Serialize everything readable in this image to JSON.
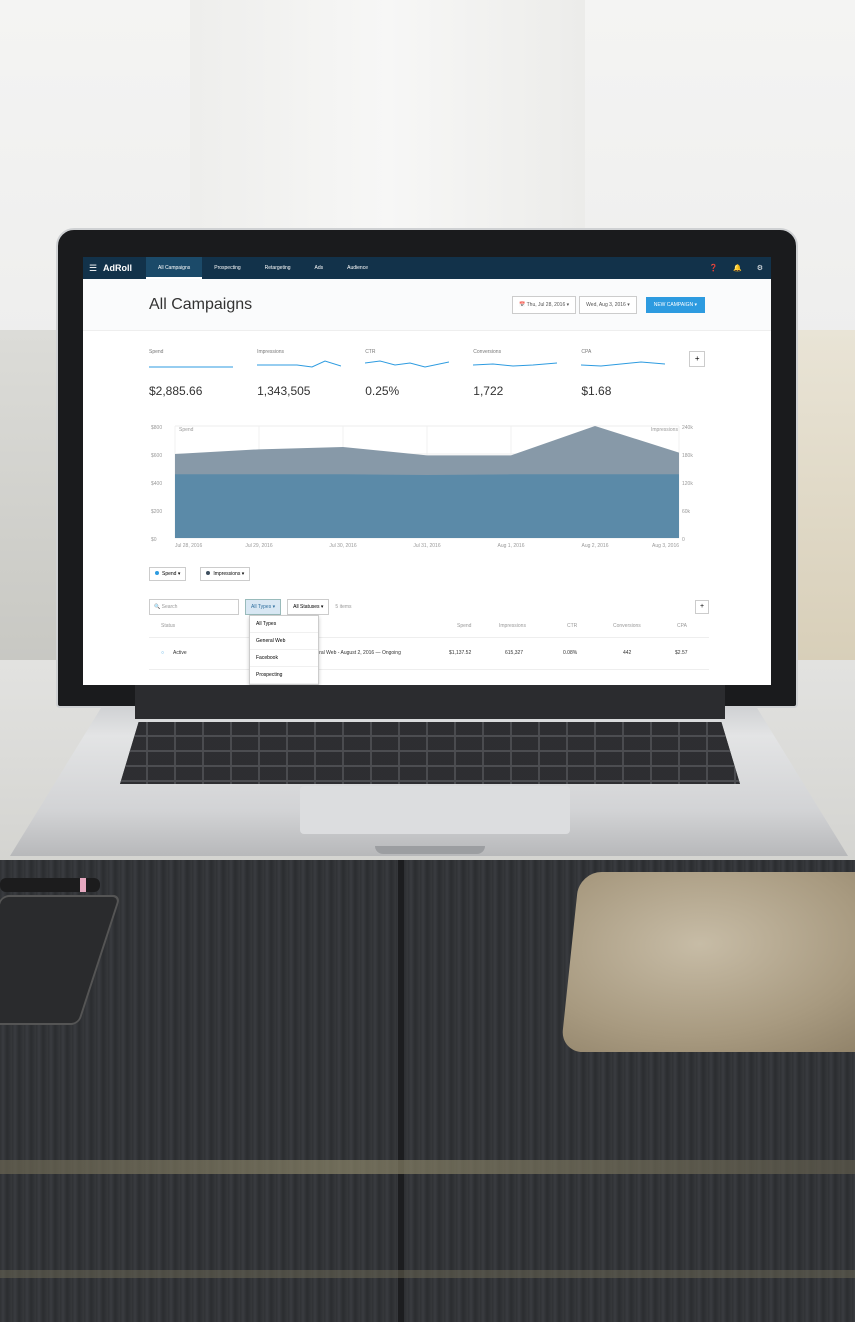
{
  "app": {
    "logo": "AdRoll"
  },
  "nav": {
    "tabs": [
      "All Campaigns",
      "Prospecting",
      "Retargeting",
      "Ads",
      "Audience"
    ],
    "active": "All Campaigns"
  },
  "header": {
    "title": "All Campaigns",
    "start_date": "Thu, Jul 28, 2016",
    "end_date": "Wed, Aug 3, 2016",
    "new_campaign": "NEW CAMPAIGN"
  },
  "metrics": [
    {
      "label": "Spend",
      "value": "$2,885.66"
    },
    {
      "label": "Impressions",
      "value": "1,343,505"
    },
    {
      "label": "CTR",
      "value": "0.25%"
    },
    {
      "label": "Conversions",
      "value": "1,722"
    },
    {
      "label": "CPA",
      "value": "$1.68"
    }
  ],
  "colors": {
    "accent": "#2d9be0",
    "nav": "#12324a",
    "spend_area": "#5b8aa8",
    "impressions_area": "#8799a8"
  },
  "chart_data": {
    "type": "area",
    "x": [
      "Jul 28, 2016",
      "Jul 29, 2016",
      "Jul 30, 2016",
      "Jul 31, 2016",
      "Aug 1, 2016",
      "Aug 2, 2016",
      "Aug 3, 2016"
    ],
    "y_left_label": "Spend",
    "y_right_label": "Impressions",
    "y_left_ticks": [
      "$800",
      "$600",
      "$400",
      "$200",
      "$0"
    ],
    "y_right_ticks": [
      "240k",
      "180k",
      "120k",
      "60k",
      "0"
    ],
    "ylim": [
      0,
      800
    ],
    "series": [
      {
        "name": "Impressions",
        "axis": "right",
        "values": [
          180000,
          190000,
          195000,
          177000,
          177000,
          240000,
          183000
        ]
      },
      {
        "name": "Spend",
        "axis": "left",
        "values": [
          455,
          455,
          455,
          450,
          455,
          455,
          455
        ]
      }
    ],
    "legend": [
      "Spend",
      "Impressions"
    ]
  },
  "filters": {
    "search_placeholder": "Search",
    "types": "All Types",
    "statuses": "All Statuses",
    "items": "5 items"
  },
  "dropdown": [
    "All Types",
    "General Web",
    "Facebook",
    "Prospecting"
  ],
  "table": {
    "headers": [
      "Status",
      "Spend",
      "Impressions",
      "CTR",
      "Conversions",
      "CPA"
    ],
    "rows": [
      {
        "status": "Active",
        "name": "General Web - August 2, 2016 — Ongoing",
        "spend": "$1,137.52",
        "impressions": "615,327",
        "ctr": "0.08%",
        "conversions": "442",
        "cpa": "$2.57"
      }
    ]
  }
}
